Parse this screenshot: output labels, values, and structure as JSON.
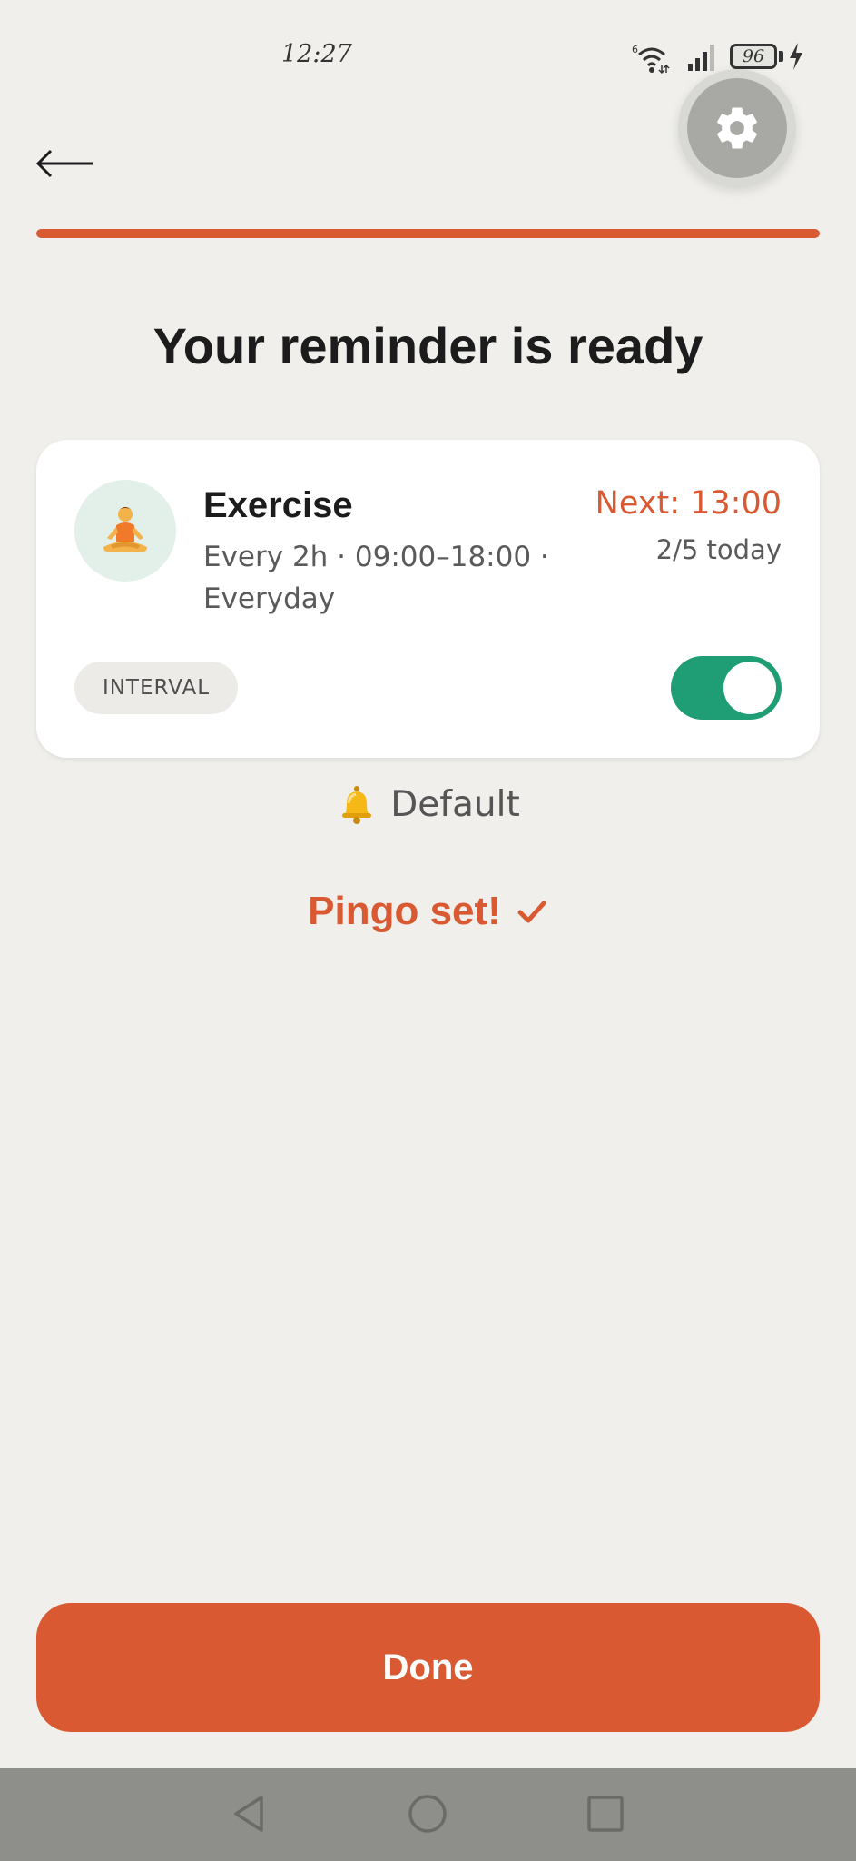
{
  "status_bar": {
    "time": "12:27",
    "battery": "96",
    "wifi_badge": "6"
  },
  "header": {
    "back_icon": "arrow-left-icon",
    "settings_icon": "gear-icon"
  },
  "progress": {
    "fraction": 1.0,
    "color": "#d95a32"
  },
  "title": "Your reminder is ready",
  "reminder": {
    "icon": "person-meditating-emoji",
    "name": "Exercise",
    "schedule": "Every 2h · 09:00–18:00 · Everyday",
    "next": "Next: 13:00",
    "progress_today": "2/5 today",
    "type": "INTERVAL",
    "enabled": true,
    "toggle_color": "#1f9e75"
  },
  "sound": {
    "icon": "bell-icon",
    "label": "Default"
  },
  "confirmation": {
    "label": "Pingo set!",
    "icon": "checkmark-icon"
  },
  "done_button": {
    "label": "Done"
  },
  "nav": {
    "back_icon": "nav-back-icon",
    "home_icon": "nav-home-icon",
    "recents_icon": "nav-recents-icon"
  },
  "colors": {
    "accent": "#d95a32",
    "background": "#f0efeb",
    "card": "#ffffff"
  }
}
